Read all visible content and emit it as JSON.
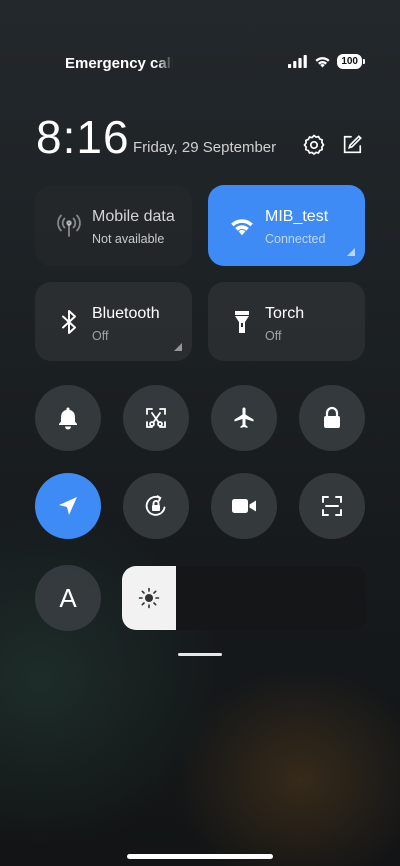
{
  "status": {
    "carrier": "Emergency calls only",
    "battery": "100"
  },
  "header": {
    "time": "8:16",
    "date": "Friday, 29 September"
  },
  "tiles": [
    {
      "name": "mobile-data",
      "title": "Mobile data",
      "subtitle": "Not available",
      "state": "disabled"
    },
    {
      "name": "wifi",
      "title": "MIB_test",
      "subtitle": "Connected",
      "state": "on"
    },
    {
      "name": "bluetooth",
      "title": "Bluetooth",
      "subtitle": "Off",
      "state": "off"
    },
    {
      "name": "torch",
      "title": "Torch",
      "subtitle": "Off",
      "state": "off"
    }
  ],
  "toggles_row1": [
    "bell-icon",
    "screenshot-icon",
    "airplane-icon",
    "lock-icon"
  ],
  "toggles_row2": [
    "location-icon",
    "rotation-lock-icon",
    "video-camera-icon",
    "scan-icon"
  ],
  "auto_brightness_label": "A",
  "brightness": {
    "level": 0.22
  },
  "colors": {
    "accent": "#3e8bf5"
  }
}
